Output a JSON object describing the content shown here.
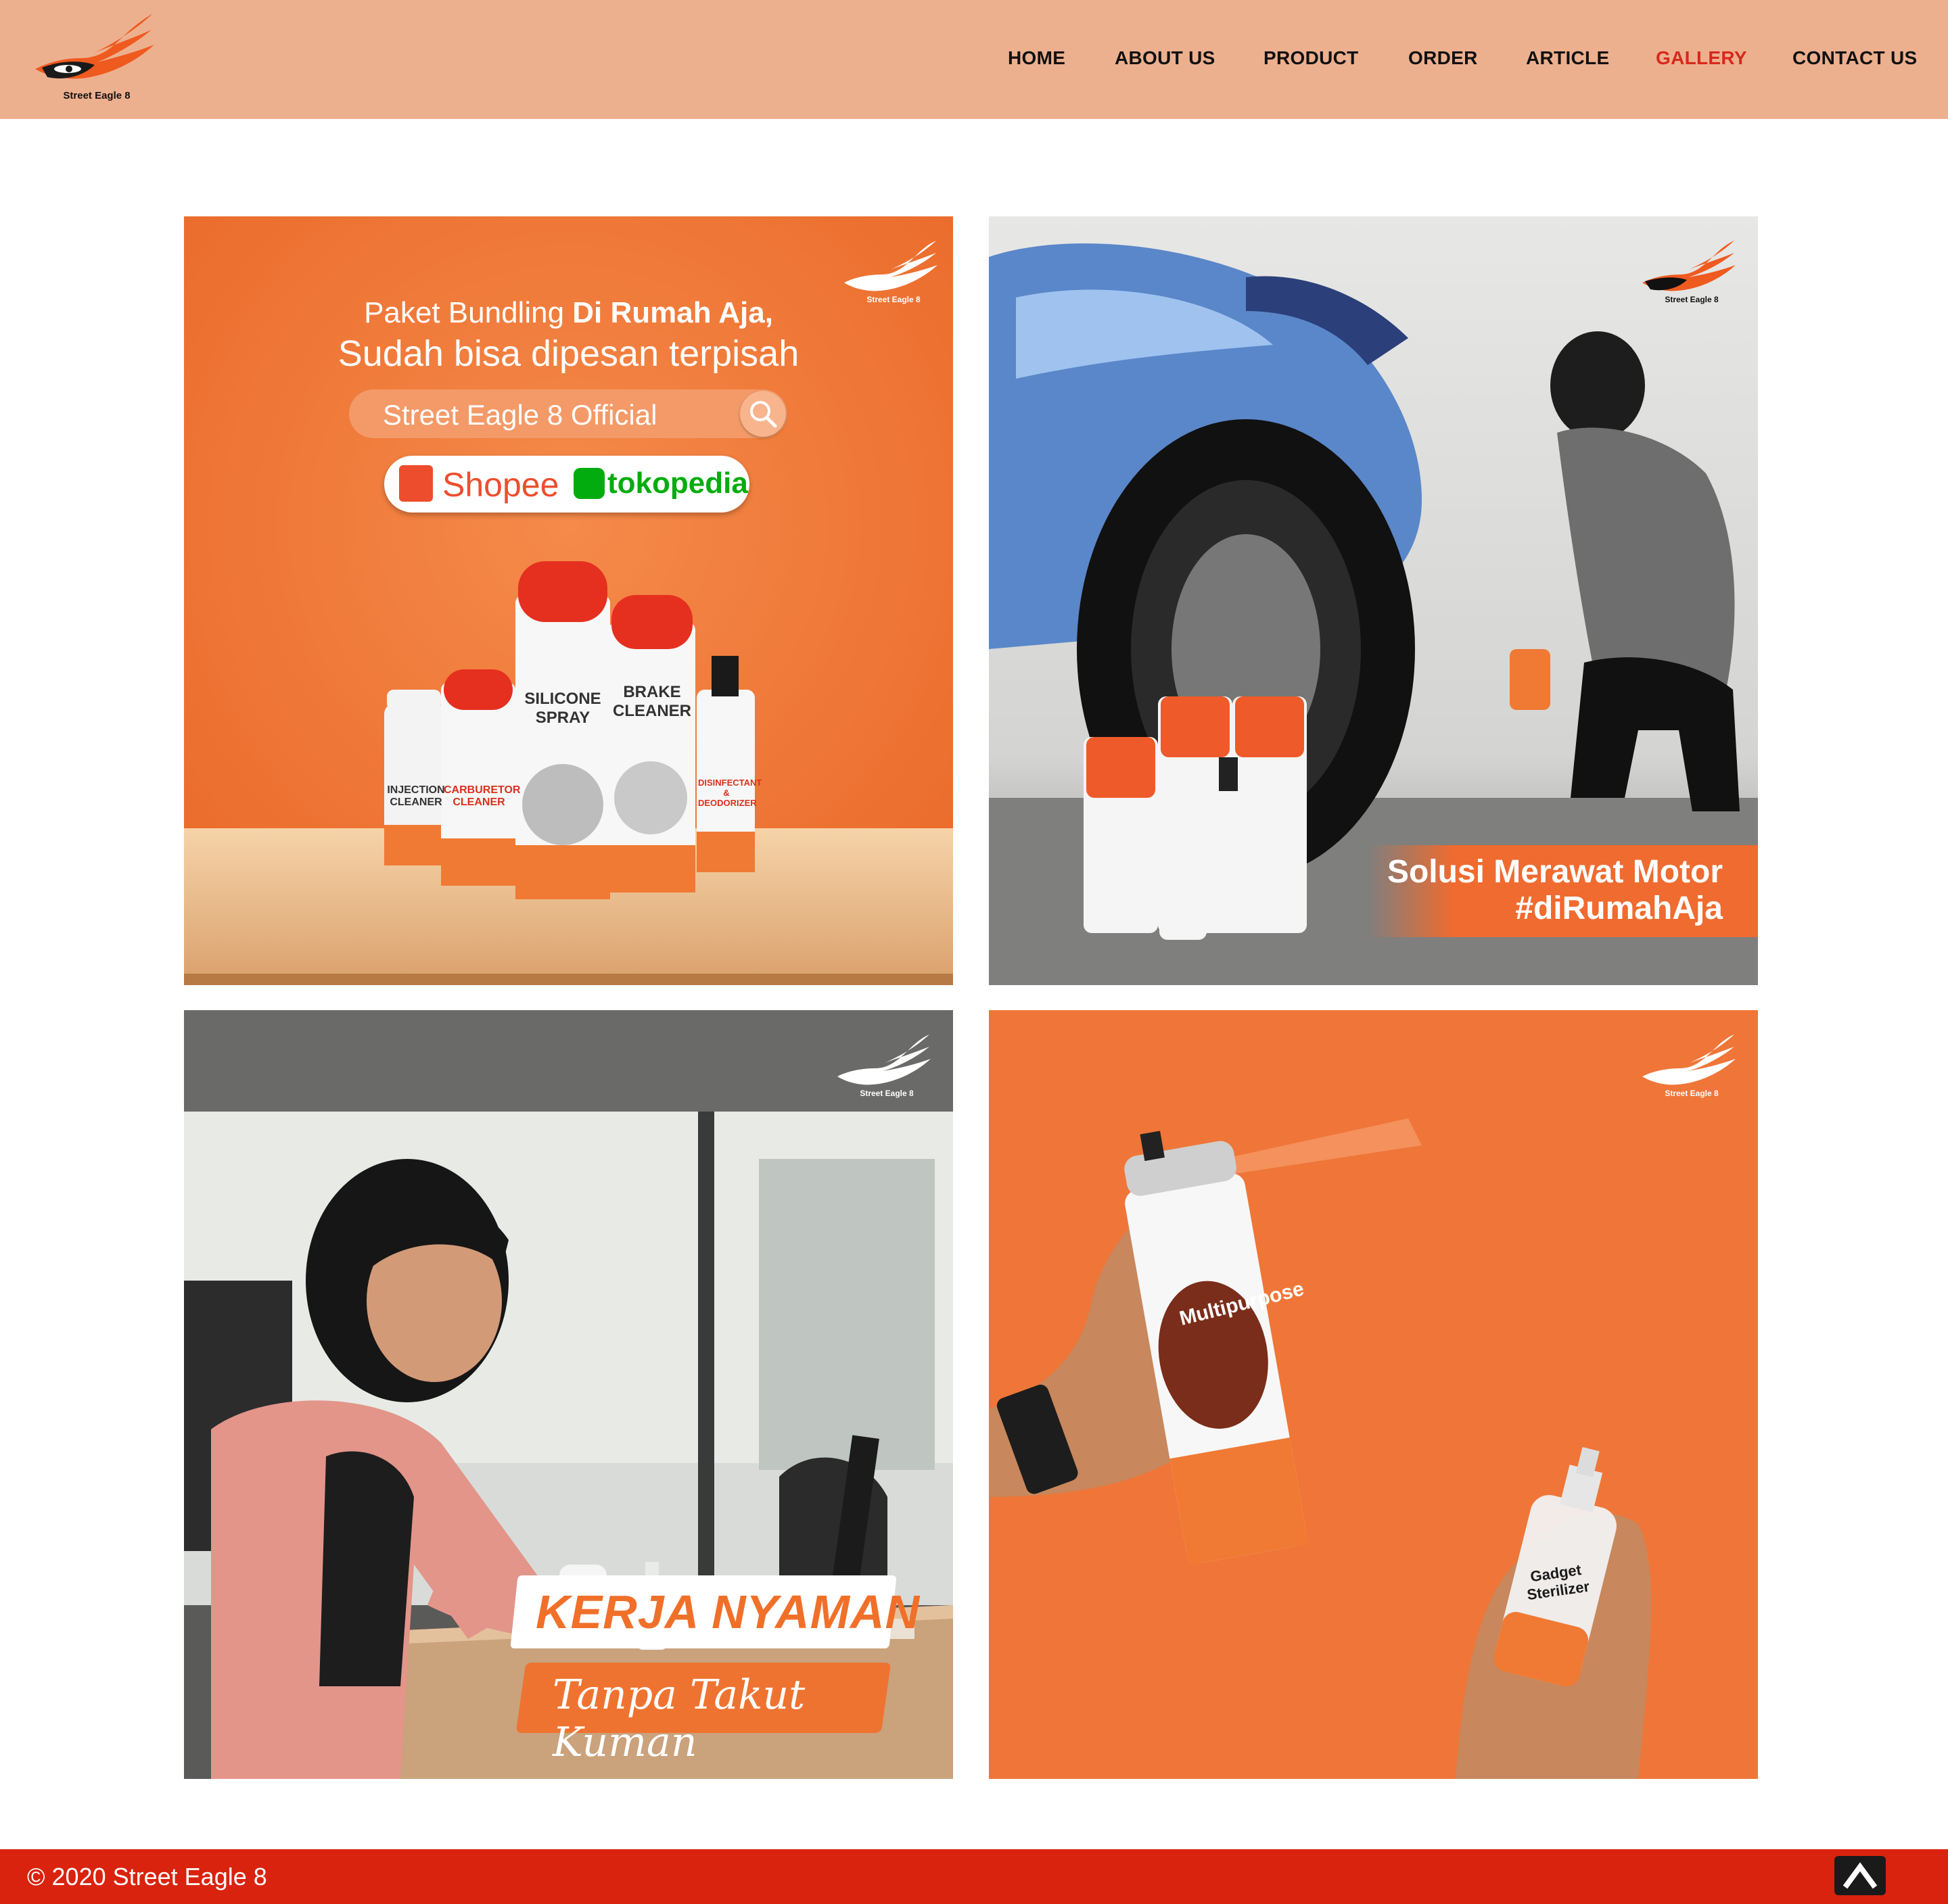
{
  "brand": {
    "name": "Street Eagle 8",
    "colors": {
      "header_bg": "#edb08f",
      "accent": "#d8281c",
      "orange": "#ef6b2f",
      "footer_bg": "#d9230e"
    }
  },
  "nav": {
    "items": [
      "HOME",
      "ABOUT US",
      "PRODUCT",
      "ORDER",
      "ARTICLE",
      "GALLERY",
      "CONTACT US"
    ],
    "active": "GALLERY"
  },
  "gallery": {
    "tile1": {
      "line1_prefix": "Paket Bundling ",
      "line1_bold": "Di Rumah Aja,",
      "line2": "Sudah bisa dipesan terpisah",
      "search_text": "Street Eagle 8 Official",
      "shop1": "Shopee",
      "shop2": "tokopedia",
      "products": [
        "INJECTION CLEANER",
        "CARBURETOR CLEANER",
        "SILICONE SPRAY",
        "BRAKE CLEANER",
        "DISINFECTANT & DEODORIZER"
      ]
    },
    "tile2": {
      "line1": "Solusi Merawat Motor",
      "line2": "#diRumahAja"
    },
    "tile3": {
      "title": "KERJA NYAMAN",
      "subtitle": "Tanpa Takut Kuman"
    },
    "tile4": {
      "product1": "Multipurpose",
      "product2": "Gadget Sterilizer"
    }
  },
  "footer": {
    "copyright": "© 2020 Street Eagle 8",
    "back_to_top_icon": "chevron-up-icon"
  }
}
